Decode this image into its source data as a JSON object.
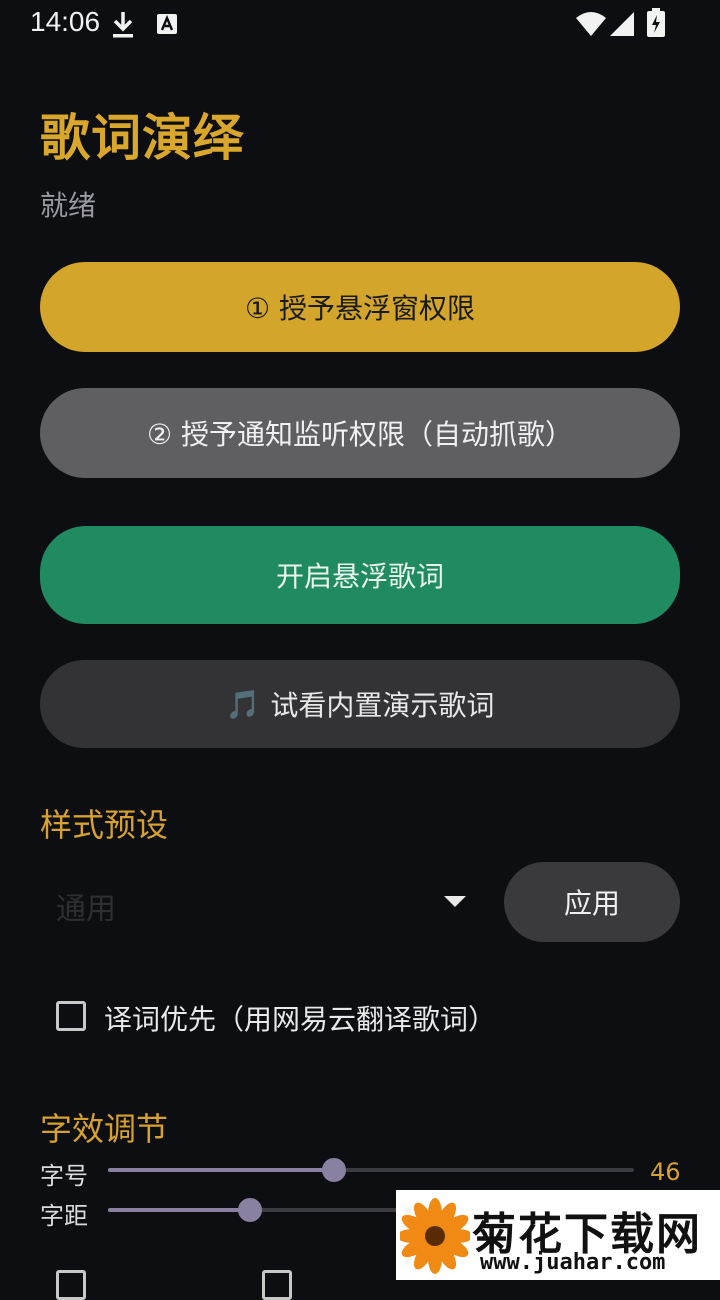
{
  "status_bar": {
    "time": "14:06",
    "icons": [
      "download-icon",
      "keyboard-a-icon",
      "wifi-icon",
      "signal-icon",
      "battery-charging-icon"
    ]
  },
  "app": {
    "title": "歌词演绎",
    "status": "就绪"
  },
  "buttons": {
    "overlay_permission": "① 授予悬浮窗权限",
    "notification_permission": "② 授予通知监听权限（自动抓歌）",
    "start_floating_lyrics": "开启悬浮歌词",
    "demo_emoji": "🎵",
    "demo_lyrics": "试看内置演示歌词"
  },
  "style_preset": {
    "title": "样式预设",
    "selected": "通用",
    "apply_label": "应用"
  },
  "translation_checkbox": {
    "label": "译词优先（用网易云翻译歌词）",
    "checked": false
  },
  "font_effects": {
    "title": "字效调节",
    "sliders": [
      {
        "label": "字号",
        "value": "46",
        "fraction": 0.43
      },
      {
        "label": "字距",
        "value": "",
        "fraction": 0.27
      }
    ]
  },
  "watermark": {
    "text": "菊花下载网",
    "url": "www.juahar.com"
  },
  "colors": {
    "background": "#0d0e12",
    "accent_gold": "#d3a52b",
    "accent_green": "#208b60",
    "slider": "#8a80a2"
  }
}
